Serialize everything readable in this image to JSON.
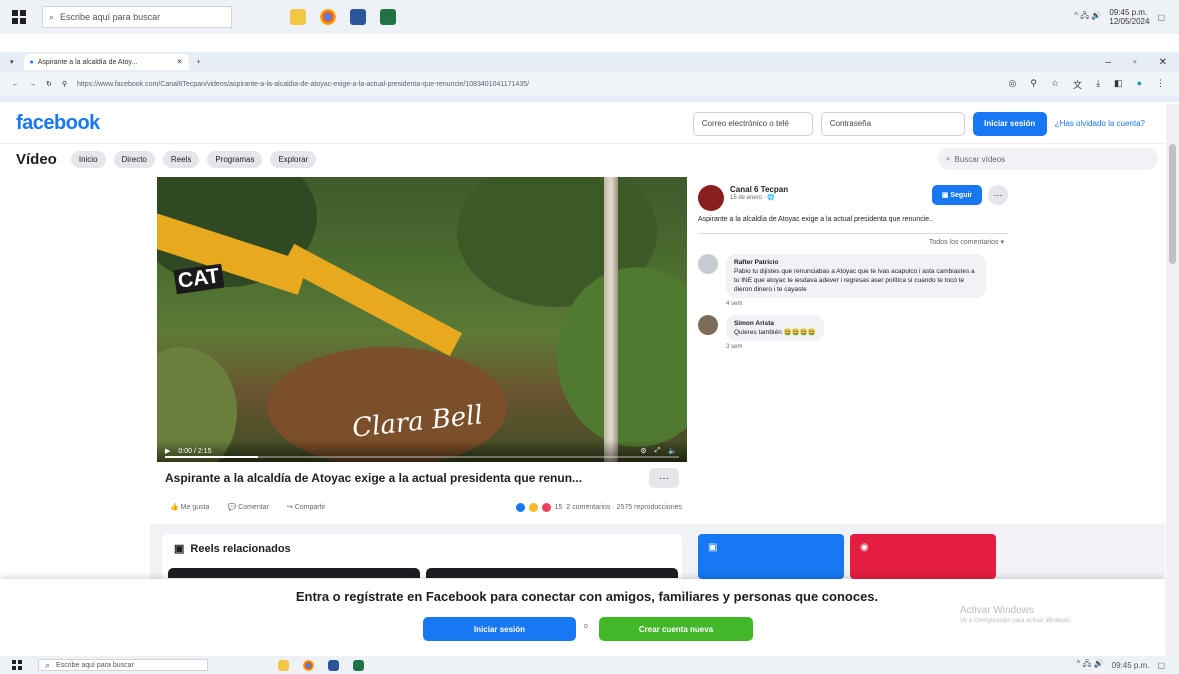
{
  "taskbar": {
    "search_placeholder": "Escribe aquí para buscar",
    "clock_time": "09:45 p.m.",
    "clock_date": "12/05/2024"
  },
  "browser": {
    "tab_title": "Aspirante a la alcaldía de Atoy...",
    "url": "https://www.facebook.com/Canal6Tecpan/videos/aspirante-a-la-alcaldia-de-atoyac-exige-a-la-actual-presidenta-que-renuncie/1083401041171435/"
  },
  "fb": {
    "logo": "facebook",
    "email_placeholder": "Correo electrónico o telé",
    "password_placeholder": "Contraseña",
    "login_label": "Iniciar sesión",
    "forgot_label": "¿Has olvidado la cuenta?"
  },
  "subnav": {
    "title": "Vídeo",
    "pills": [
      "Inicio",
      "Directo",
      "Reels",
      "Programas",
      "Explorar"
    ],
    "search_placeholder": "Buscar vídeos"
  },
  "video": {
    "cat_logo": "CAT",
    "watermark": "Clara Bell",
    "time": "0:00 / 2:15",
    "progress": 0.18,
    "title": "Aspirante a la alcaldía de Atoyac exige a la actual presidenta que renun...",
    "like_label": "Me gusta",
    "comment_label": "Comentar",
    "share_label": "Compartir",
    "reactions_count": "15",
    "stats": "2 comentarios · 2575 reproducciones"
  },
  "panel": {
    "page_name": "Canal 6 Tecpan",
    "page_date": "15 de enero · 🌐",
    "follow_label": "Seguir",
    "description": "Aspirante a la alcaldía de Atoyac exige a la actual presidenta que renuncie..",
    "all_comments": "Todos los comentarios ▾",
    "comments": [
      {
        "author": "Rafter Patricio",
        "text": "Pabio tu dijistes que renunciabas a Atoyac que te ivas acapulco i asta cambiastes a tu INE que atoyac te iesdava adever i regresas aser política si cuando te tocó te dieron dinero i te cayaste",
        "time": "4 sem"
      },
      {
        "author": "Simon Arista",
        "text": "Quieres también 🤮🤮🤮🤮",
        "time": "3 sem"
      }
    ]
  },
  "lower": {
    "reels_title": "Reels relacionados"
  },
  "overlay": {
    "text": "Entra o regístrate en Facebook para conectar con amigos, familiares y personas que conoces.",
    "login_label": "Iniciar sesión",
    "or_label": "o",
    "create_label": "Crear cuenta nueva",
    "activate_title": "Activar Windows",
    "activate_sub": "Ve a Configuración para activar Windows."
  },
  "colors": {
    "fb_blue": "#1877f2",
    "create_green": "#42b72a",
    "promo_blue": "#1877f2",
    "promo_red": "#e41e3f"
  }
}
